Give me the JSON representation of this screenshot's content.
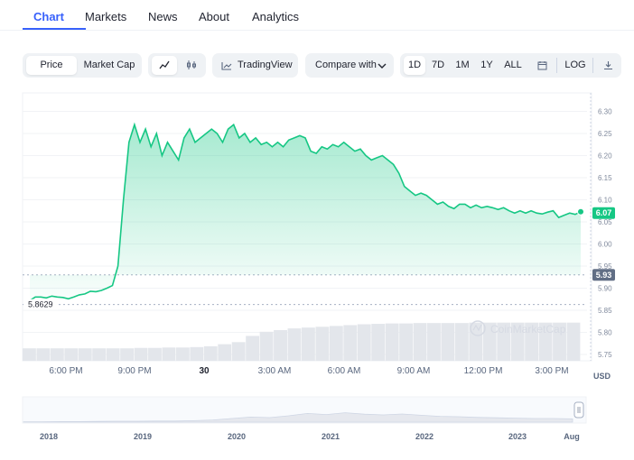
{
  "tabs": [
    "Chart",
    "Markets",
    "News",
    "About",
    "Analytics"
  ],
  "toolbar": {
    "price": "Price",
    "market_cap": "Market Cap",
    "tradingview": "TradingView",
    "compare": "Compare with",
    "ranges": [
      "1D",
      "7D",
      "1M",
      "1Y",
      "ALL"
    ],
    "log": "LOG"
  },
  "chart_data": {
    "type": "area",
    "x_ticks": [
      "6:00 PM",
      "9:00 PM",
      "30",
      "3:00 AM",
      "6:00 AM",
      "9:00 AM",
      "12:00 PM",
      "3:00 PM"
    ],
    "y_ticks": [
      "6.30",
      "6.25",
      "6.20",
      "6.15",
      "6.10",
      "6.05",
      "6.00",
      "5.95",
      "5.90",
      "5.85",
      "5.80",
      "5.75"
    ],
    "ylim": [
      5.75,
      6.3
    ],
    "currency": "USD",
    "current_price": "6.07",
    "reference_price": "5.93",
    "low_label": "5.8629",
    "watermark": "CoinMarketCap",
    "accent_color": "#16c784",
    "series": [
      {
        "values": [
          5.872,
          5.88,
          5.88,
          5.878,
          5.882,
          5.88,
          5.879,
          5.876,
          5.88,
          5.885,
          5.887,
          5.893,
          5.892,
          5.895,
          5.9,
          5.906,
          5.95,
          6.1,
          6.23,
          6.27,
          6.23,
          6.26,
          6.22,
          6.25,
          6.2,
          6.23,
          6.21,
          6.19,
          6.24,
          6.26,
          6.23,
          6.24,
          6.25,
          6.26,
          6.25,
          6.23,
          6.26,
          6.27,
          6.24,
          6.25,
          6.23,
          6.24,
          6.225,
          6.23,
          6.22,
          6.23,
          6.22,
          6.235,
          6.24,
          6.245,
          6.24,
          6.21,
          6.205,
          6.22,
          6.215,
          6.225,
          6.22,
          6.23,
          6.22,
          6.21,
          6.215,
          6.2,
          6.19,
          6.195,
          6.2,
          6.19,
          6.18,
          6.16,
          6.13,
          6.12,
          6.11,
          6.115,
          6.11,
          6.1,
          6.09,
          6.095,
          6.085,
          6.08,
          6.09,
          6.09,
          6.082,
          6.088,
          6.082,
          6.085,
          6.082,
          6.078,
          6.082,
          6.075,
          6.07,
          6.075,
          6.07,
          6.075,
          6.07,
          6.068,
          6.072,
          6.075,
          6.06,
          6.065,
          6.07,
          6.067,
          6.073
        ]
      }
    ],
    "volume": [
      0.3,
      0.3,
      0.3,
      0.3,
      0.3,
      0.3,
      0.3,
      0.3,
      0.31,
      0.31,
      0.32,
      0.32,
      0.33,
      0.35,
      0.4,
      0.45,
      0.6,
      0.7,
      0.74,
      0.78,
      0.8,
      0.82,
      0.84,
      0.86,
      0.88,
      0.89,
      0.9,
      0.9,
      0.91,
      0.91,
      0.91,
      0.91,
      0.92,
      0.92,
      0.92,
      0.92,
      0.92,
      0.92,
      0.92,
      0.92
    ],
    "navigator": {
      "labels": [
        "2018",
        "2019",
        "2020",
        "2021",
        "2022",
        "2023",
        "Aug"
      ],
      "values": [
        0.02,
        0.02,
        0.03,
        0.03,
        0.04,
        0.05,
        0.05,
        0.06,
        0.06,
        0.08,
        0.12,
        0.2,
        0.28,
        0.25,
        0.35,
        0.48,
        0.42,
        0.52,
        0.44,
        0.4,
        0.45,
        0.38,
        0.32,
        0.3,
        0.26,
        0.24,
        0.22,
        0.2,
        0.2,
        0.18
      ]
    }
  }
}
